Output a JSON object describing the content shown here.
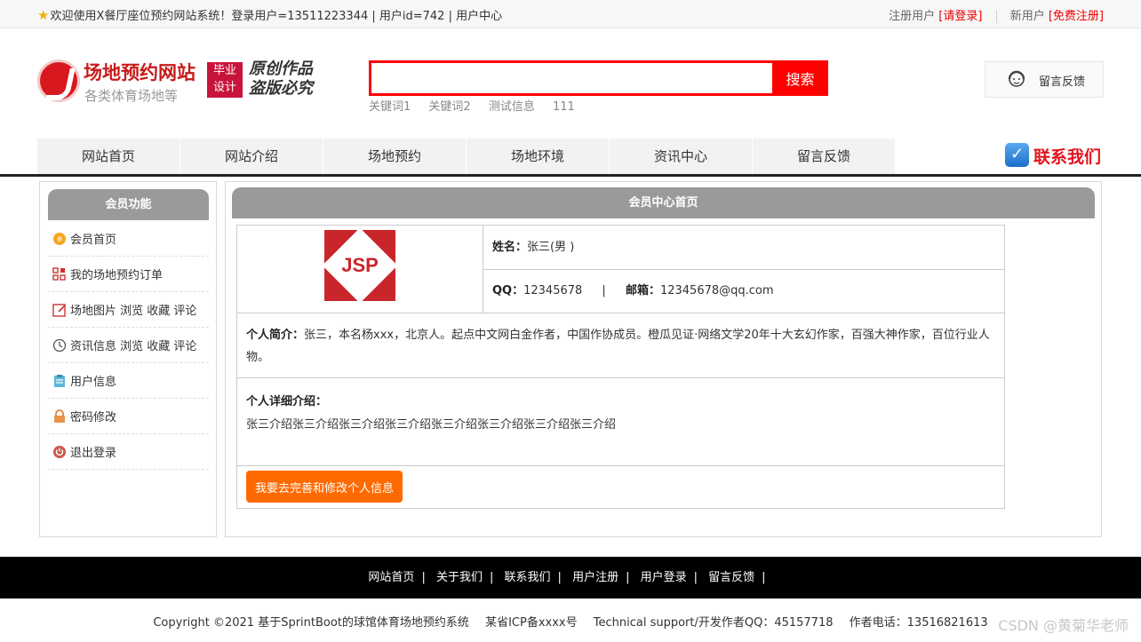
{
  "topbar": {
    "welcome": "欢迎使用X餐厅座位预约网站系统！登录用户=13511223344 | 用户id=742 | 用户中心",
    "register_label": "注册用户",
    "login_link": "[请登录]",
    "newuser_label": "新用户",
    "signup_link": "[免费注册]"
  },
  "header": {
    "title": "场地预约网站",
    "subtitle": "各类体育场地等",
    "badge_line1": "毕业",
    "badge_line2": "设计",
    "slogan_line1": "原创作品",
    "slogan_line2": "盗版必究",
    "search_button": "搜索",
    "search_placeholder": "",
    "hotwords": [
      "关键词1",
      "关键词2",
      "测试信息",
      "111"
    ],
    "feedback_label": "留言反馈"
  },
  "nav": {
    "items": [
      "网站首页",
      "网站介绍",
      "场地预约",
      "场地环境",
      "资讯中心",
      "留言反馈"
    ],
    "contact": "联系我们"
  },
  "sidebar": {
    "title": "会员功能",
    "items": [
      {
        "label": "会员首页",
        "icon": "home-icon"
      },
      {
        "label": "我的场地预约订单",
        "icon": "order-icon"
      },
      {
        "label": "场地图片 浏览 收藏 评论",
        "icon": "edit-icon"
      },
      {
        "label": "资讯信息 浏览 收藏 评论",
        "icon": "history-icon"
      },
      {
        "label": "用户信息",
        "icon": "clipboard-icon"
      },
      {
        "label": "密码修改",
        "icon": "lock-icon"
      },
      {
        "label": "退出登录",
        "icon": "power-icon"
      }
    ]
  },
  "main": {
    "title": "会员中心首页",
    "avatar_text": "JSP",
    "name_label": "姓名：",
    "name_value": "张三(男 )",
    "qq_label": "QQ：",
    "qq_value": "12345678",
    "divider": "|",
    "email_label": "邮箱：",
    "email_value": "12345678@qq.com",
    "intro_label": "个人简介：",
    "intro_value": "张三，本名杨xxx，北京人。起点中文网白金作者，中国作协成员。橙瓜见证·网络文学20年十大玄幻作家，百强大神作家，百位行业人物。",
    "detail_label": "个人详细介绍：",
    "detail_value": "张三介绍张三介绍张三介绍张三介绍张三介绍张三介绍张三介绍张三介绍",
    "edit_button": "我要去完善和修改个人信息"
  },
  "footer": {
    "links": [
      "网站首页",
      "关于我们",
      "联系我们",
      "用户注册",
      "用户登录",
      "留言反馈"
    ],
    "separator": "|",
    "copyright": "Copyright ©2021 基于SprintBoot的球馆体育场地预约系统",
    "icp": "某省ICP备xxxx号",
    "support": "Technical support/开发作者QQ：45157718",
    "phone": "作者电话：13516821613",
    "watermark": "CSDN @黄菊华老师"
  },
  "colors": {
    "accent_red": "#ff0000",
    "header_gray": "#9a9a9a",
    "button_orange": "#ff6a00",
    "link_red": "#e00000"
  }
}
